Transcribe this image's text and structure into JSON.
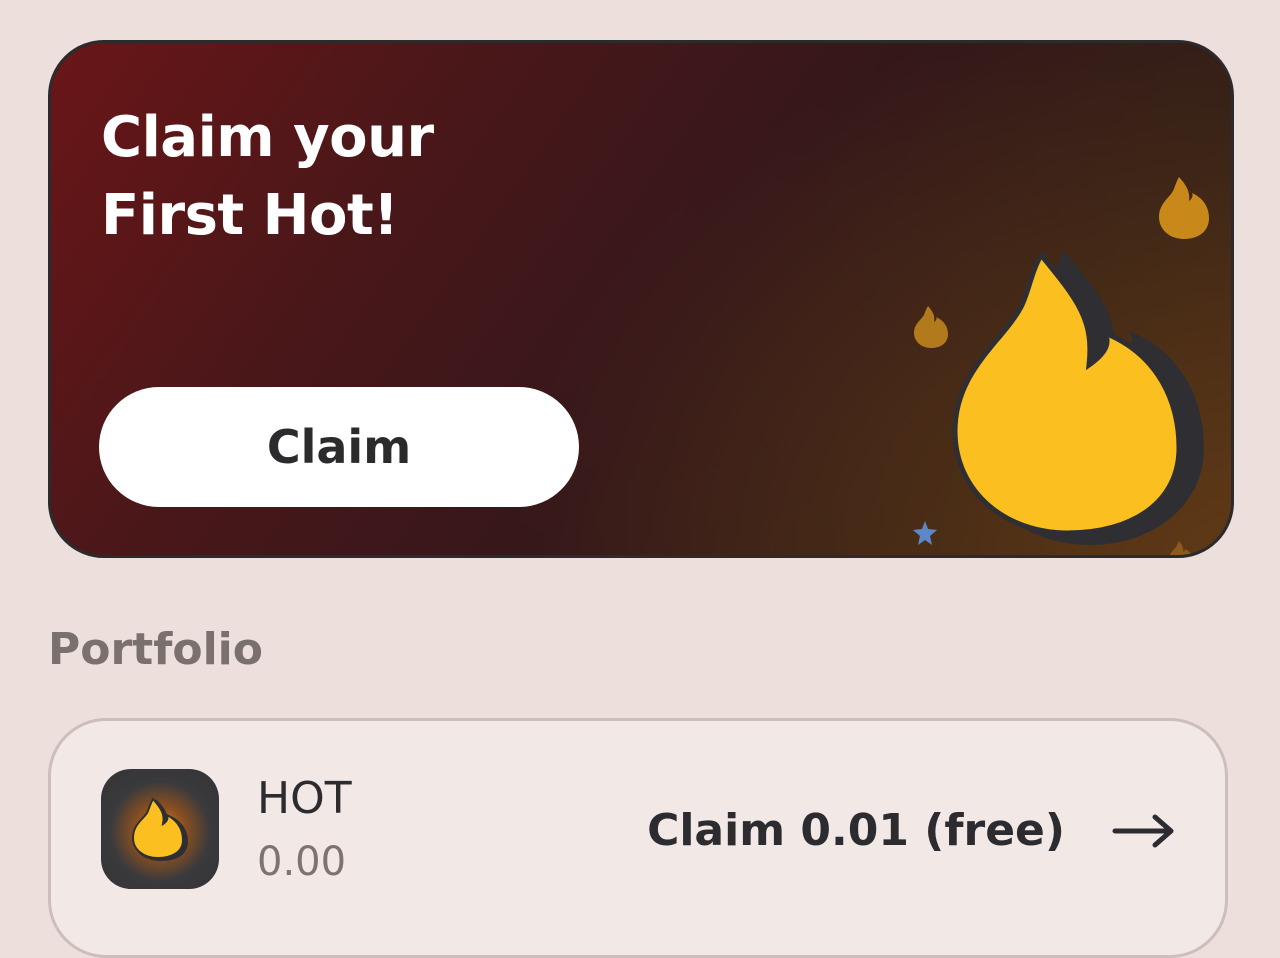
{
  "banner": {
    "title_line1": "Claim your",
    "title_line2": "First Hot!",
    "button_label": "Claim"
  },
  "portfolio": {
    "title": "Portfolio",
    "tokens": [
      {
        "symbol": "HOT",
        "balance": "0.00",
        "action_label": "Claim 0.01 (free)",
        "icon": "flame-icon"
      }
    ]
  },
  "colors": {
    "background": "#ecdfdc",
    "banner_dark_red": "#6a1618",
    "flame_yellow": "#fbbf20",
    "button_white": "#ffffff",
    "text_dark": "#2c2c30",
    "text_muted": "#7a706d"
  }
}
